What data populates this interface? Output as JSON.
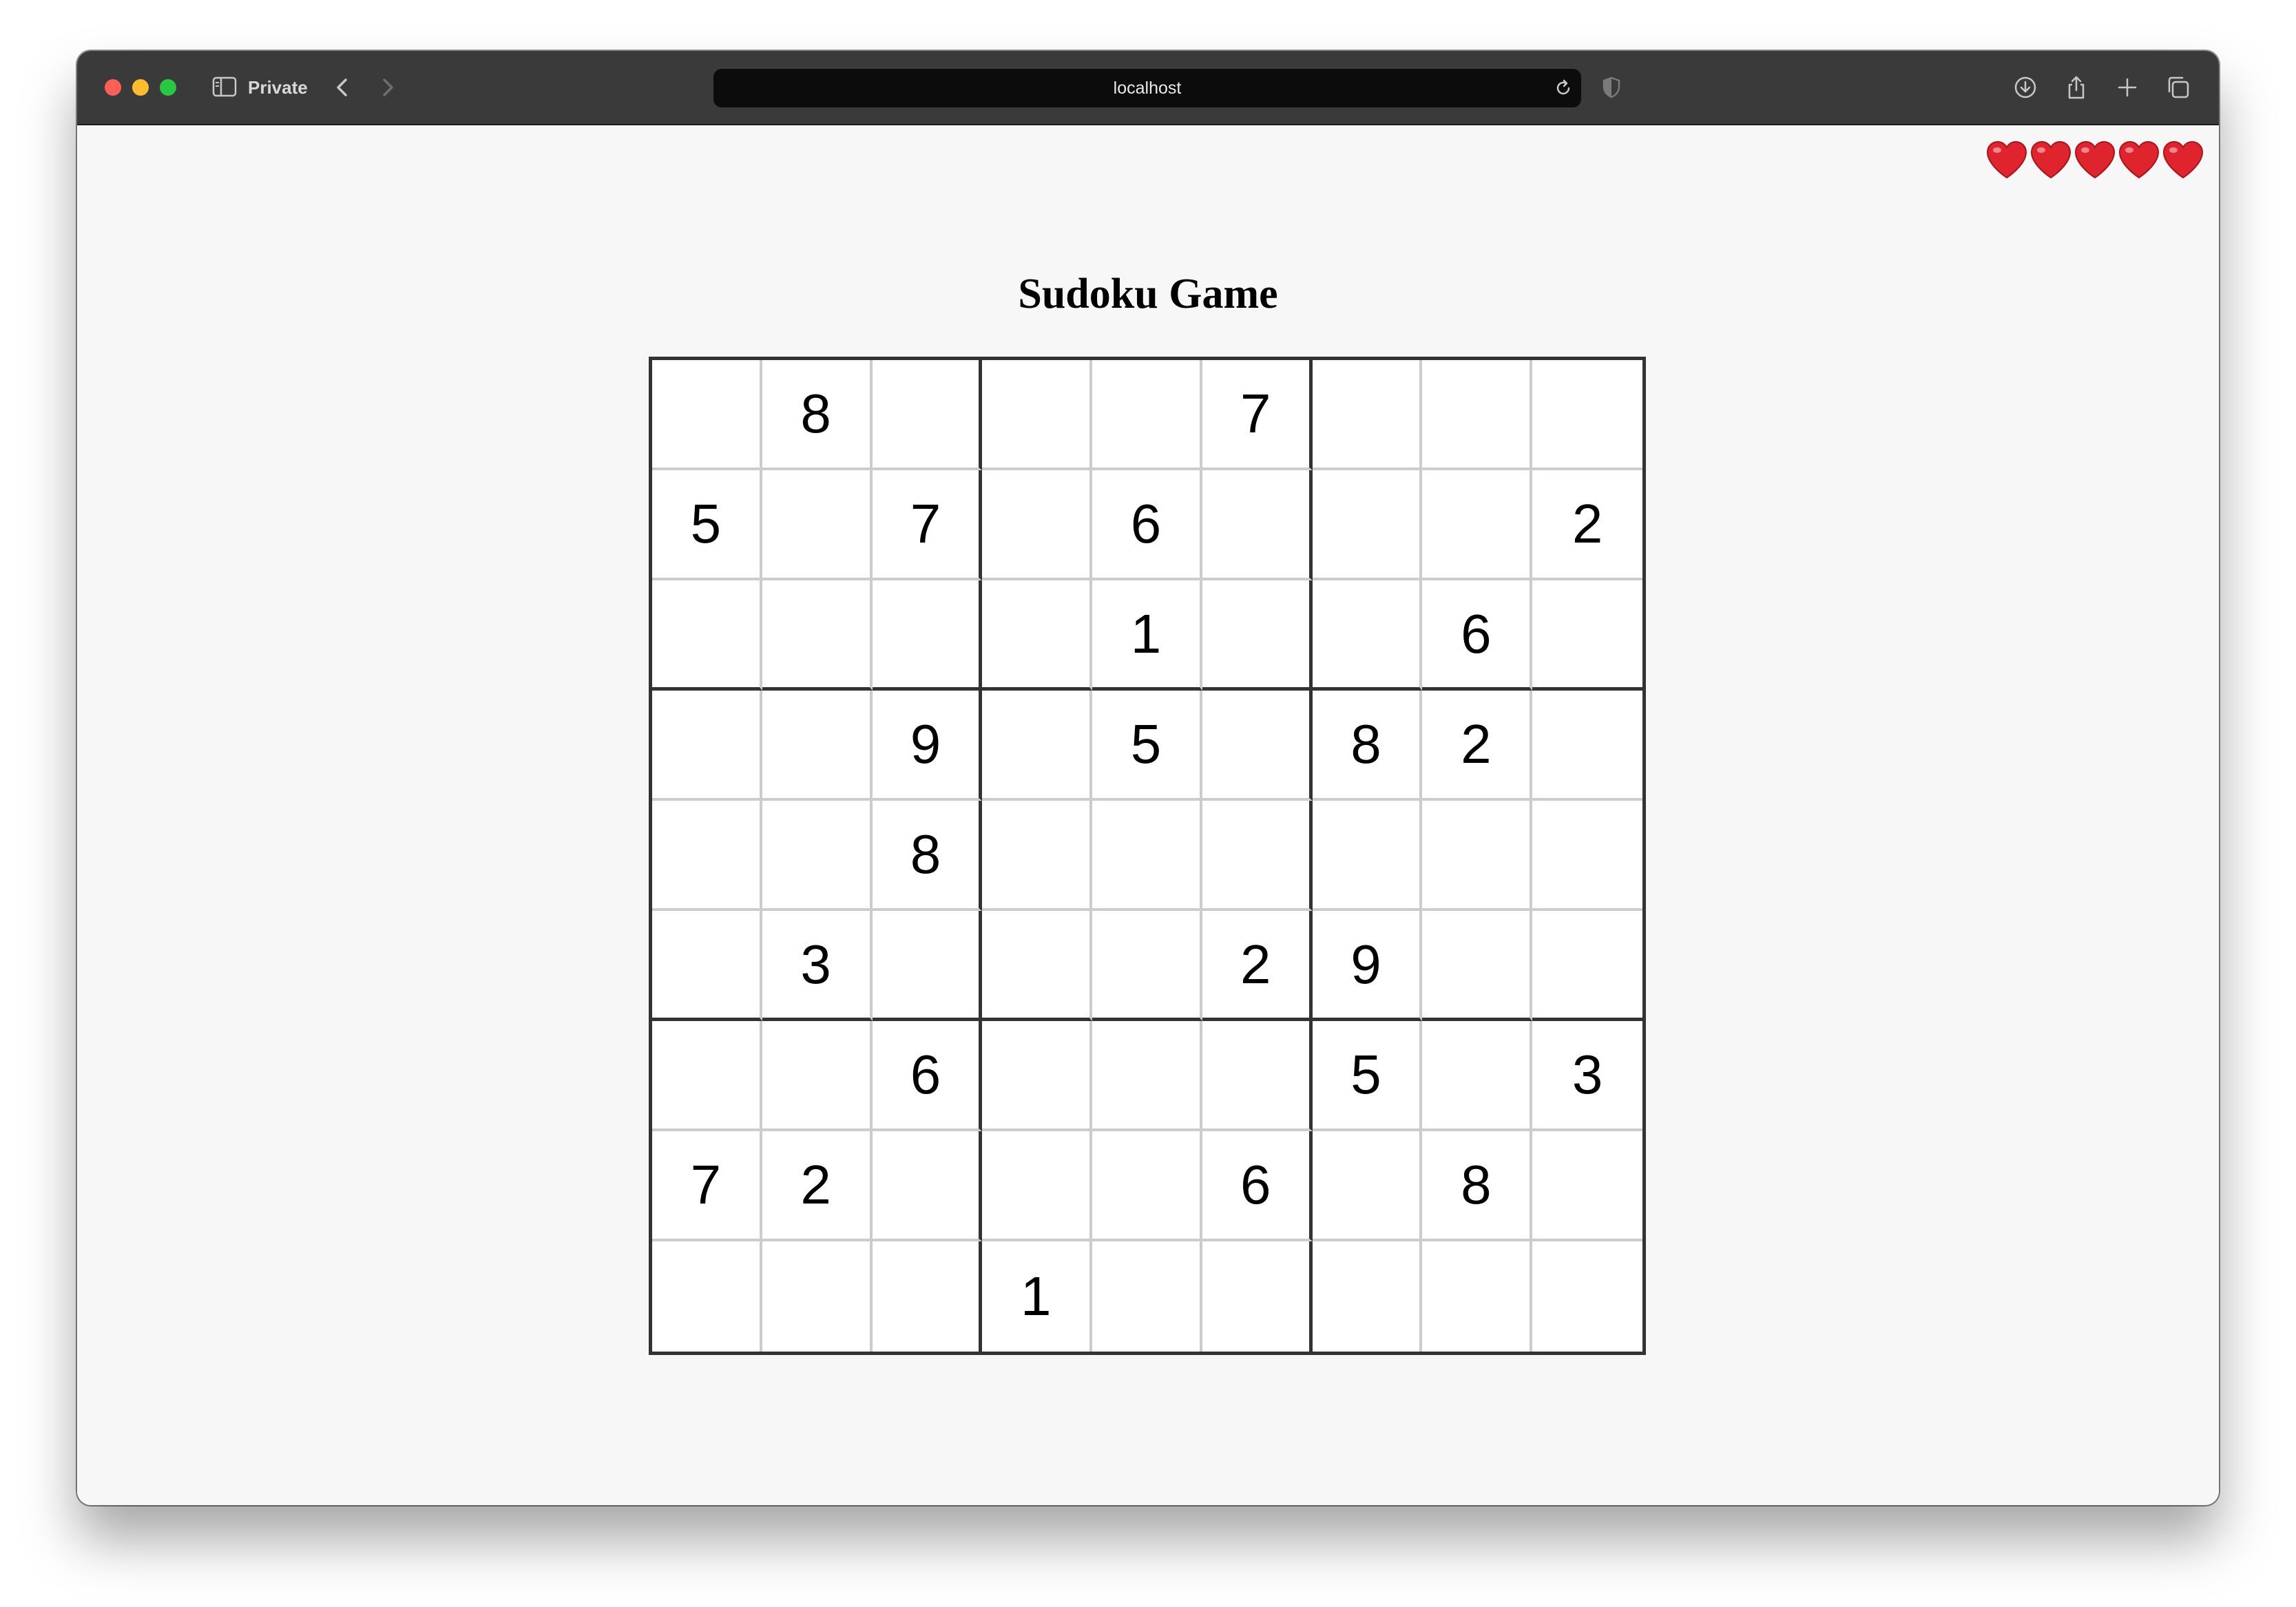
{
  "browser": {
    "private_label": "Private",
    "url": "localhost"
  },
  "game": {
    "title": "Sudoku Game",
    "lives": 5,
    "board": [
      [
        "",
        "8",
        "",
        "",
        "",
        "7",
        "",
        "",
        ""
      ],
      [
        "5",
        "",
        "7",
        "",
        "6",
        "",
        "",
        "",
        "2"
      ],
      [
        "",
        "",
        "",
        "",
        "1",
        "",
        "",
        "6",
        ""
      ],
      [
        "",
        "",
        "9",
        "",
        "5",
        "",
        "8",
        "2",
        ""
      ],
      [
        "",
        "",
        "8",
        "",
        "",
        "",
        "",
        "",
        ""
      ],
      [
        "",
        "3",
        "",
        "",
        "",
        "2",
        "9",
        "",
        ""
      ],
      [
        "",
        "",
        "6",
        "",
        "",
        "",
        "5",
        "",
        "3"
      ],
      [
        "7",
        "2",
        "",
        "",
        "",
        "6",
        "",
        "8",
        ""
      ],
      [
        "",
        "",
        "",
        "1",
        "",
        "",
        "",
        "",
        ""
      ]
    ]
  },
  "colors": {
    "heart": "#e0242e",
    "thick_border": "#333333",
    "thin_border": "#cccccc"
  }
}
